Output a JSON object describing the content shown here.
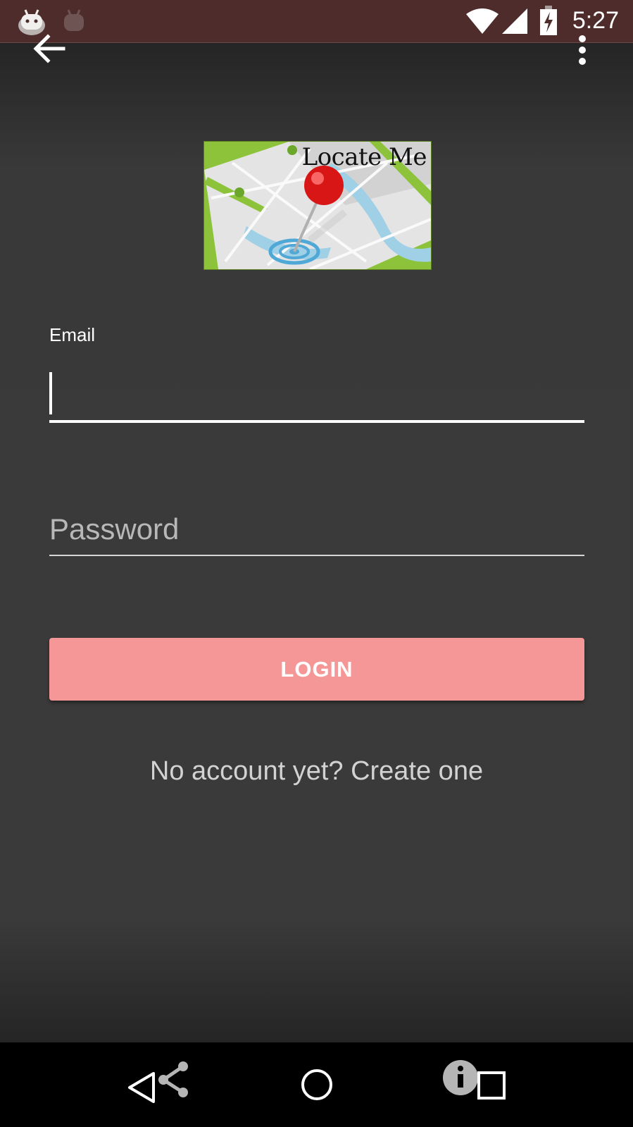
{
  "status_bar": {
    "time": "5:27",
    "icons": [
      "android-notification-icon",
      "android-notification-icon-dim",
      "wifi-icon",
      "cell-signal-icon",
      "battery-charging-icon"
    ]
  },
  "toolbar": {
    "back_icon": "arrow-back-icon",
    "more_icon": "more-vert-icon"
  },
  "logo": {
    "text": "Locate Me",
    "colors": {
      "green": "#8cc33a",
      "pin": "#e01b1b",
      "water": "#9fd0e6"
    }
  },
  "form": {
    "email_label": "Email",
    "email_value": "",
    "password_placeholder": "Password",
    "login_label": "LOGIN",
    "create_account_text": "No account yet? Create one"
  },
  "colors": {
    "login_button": "#f59796",
    "status_bar": "#4e2c2b",
    "background": "#3b3a3a"
  },
  "nav_bar": {
    "icons": [
      "back-triangle-icon",
      "share-icon",
      "home-circle-icon",
      "info-icon",
      "recents-square-icon"
    ]
  }
}
